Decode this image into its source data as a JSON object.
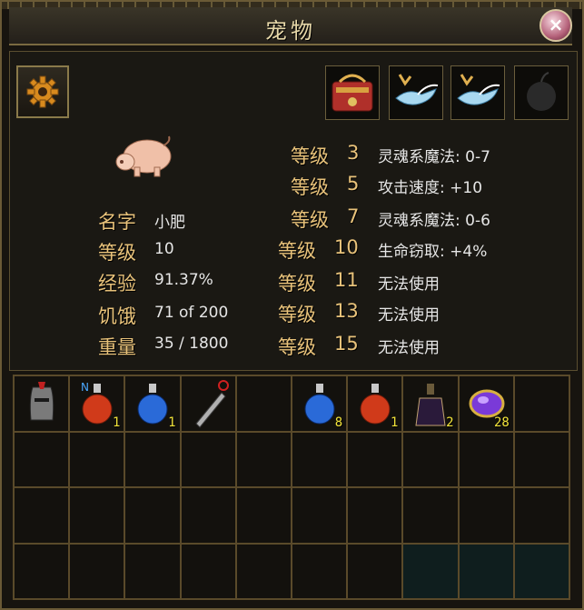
{
  "window": {
    "title": "宠物",
    "close_label": "×"
  },
  "icons": {
    "gear": "gear-icon",
    "top_slots": [
      "red-saddle-icon",
      "winged-boots-icon",
      "winged-boots-icon",
      "empty-apple-slot-icon"
    ]
  },
  "pet": {
    "stats": [
      {
        "label": "名字",
        "value": "小肥"
      },
      {
        "label": "等级",
        "value": "10"
      },
      {
        "label": "经验",
        "value": "91.37%"
      },
      {
        "label": "饥饿",
        "value": "71 of 200"
      },
      {
        "label": "重量",
        "value": "35 / 1800"
      }
    ],
    "level_skills": [
      {
        "label": "等级",
        "level": "3",
        "skill": "灵魂系魔法: 0-7"
      },
      {
        "label": "等级",
        "level": "5",
        "skill": "攻击速度: +10"
      },
      {
        "label": "等级",
        "level": "7",
        "skill": "灵魂系魔法: 0-6"
      },
      {
        "label": "等级",
        "level": "10",
        "skill": "生命窃取: +4%"
      },
      {
        "label": "等级",
        "level": "11",
        "skill": "无法使用"
      },
      {
        "label": "等级",
        "level": "13",
        "skill": "无法使用"
      },
      {
        "label": "等级",
        "level": "15",
        "skill": "无法使用"
      }
    ]
  },
  "inventory": {
    "items": [
      {
        "slot": 0,
        "icon": "helmet-icon",
        "qty": ""
      },
      {
        "slot": 1,
        "icon": "red-potion-icon",
        "qty": "1"
      },
      {
        "slot": 2,
        "icon": "blue-potion-icon",
        "qty": "1"
      },
      {
        "slot": 3,
        "icon": "sword-icon",
        "qty": ""
      },
      {
        "slot": 5,
        "icon": "blue-potion-icon",
        "qty": "8"
      },
      {
        "slot": 6,
        "icon": "red-potion-icon",
        "qty": "1"
      },
      {
        "slot": 7,
        "icon": "dark-potion-icon",
        "qty": "2"
      },
      {
        "slot": 8,
        "icon": "purple-gem-icon",
        "qty": "28"
      }
    ]
  }
}
